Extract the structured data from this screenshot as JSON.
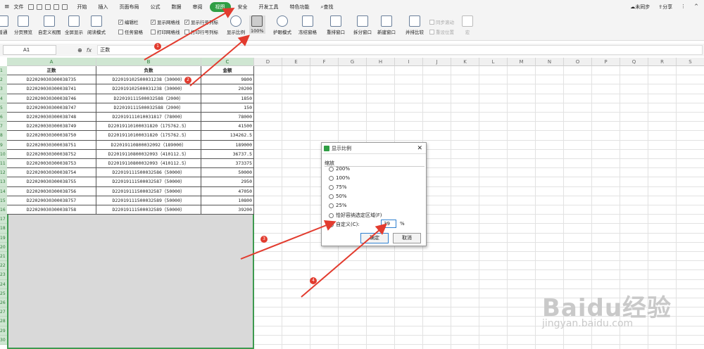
{
  "menubar": {
    "file_label": "文件",
    "tabs": [
      "开始",
      "插入",
      "页面布局",
      "公式",
      "数据",
      "审阅",
      "视图",
      "安全",
      "开发工具",
      "特色功能"
    ],
    "active_tab": "视图",
    "search_label": "查找",
    "sync_label": "未同步",
    "share_label": "分享"
  },
  "ribbon": {
    "buttons": [
      {
        "label": "普通"
      },
      {
        "label": "分页预览"
      },
      {
        "label": "自定义视图"
      },
      {
        "label": "全屏显示"
      },
      {
        "label": "阅读模式"
      },
      {
        "label": "显示比例"
      },
      {
        "label": "100%"
      },
      {
        "label": "护眼模式"
      },
      {
        "label": "冻结窗格"
      },
      {
        "label": "重排窗口"
      },
      {
        "label": "拆分窗口"
      },
      {
        "label": "新建窗口"
      },
      {
        "label": "并排比较"
      },
      {
        "label": "同步滚动"
      },
      {
        "label": "重设位置"
      },
      {
        "label": "宏"
      }
    ],
    "checks": [
      {
        "label": "编辑栏",
        "checked": true
      },
      {
        "label": "任务窗格",
        "checked": false
      },
      {
        "label": "显示网格线",
        "checked": true
      },
      {
        "label": "打印网格线",
        "checked": false
      },
      {
        "label": "显示行号列标",
        "checked": true
      },
      {
        "label": "打印行号列标",
        "checked": false
      }
    ]
  },
  "formula_bar": {
    "name_box": "A1",
    "fx": "fx",
    "value": "正数"
  },
  "columns": [
    "A",
    "B",
    "C",
    "D",
    "E",
    "F",
    "G",
    "H",
    "I",
    "J",
    "K",
    "L",
    "M",
    "N",
    "O",
    "P",
    "Q",
    "R",
    "S"
  ],
  "rows": [
    "1",
    "2",
    "3",
    "4",
    "5",
    "6",
    "7",
    "8",
    "9",
    "10",
    "11",
    "12",
    "13",
    "14",
    "15",
    "16",
    "17",
    "18",
    "19",
    "20",
    "21",
    "22",
    "23",
    "24",
    "25",
    "26",
    "27",
    "28",
    "29",
    "30"
  ],
  "sheet": {
    "headers": [
      "正数",
      "负数",
      "金额"
    ],
    "rows": [
      [
        "D22020030300038735",
        "D22019102500031238（30000）",
        "9800"
      ],
      [
        "D22020030300038741",
        "D22019102500031238（30000）",
        "20200"
      ],
      [
        "D22020030300038746",
        "D22019111500032588（2000）",
        "1850"
      ],
      [
        "D22020030300038747",
        "D22019111500032588（2000）",
        "150"
      ],
      [
        "D22020030300038748",
        "D22019111010031817（78000）",
        "78000"
      ],
      [
        "D22020030300038749",
        "D22019110100031820（175762.5）",
        "41500"
      ],
      [
        "D22020030300038750",
        "D22019110100031820（175762.5）",
        "134262.5"
      ],
      [
        "D22020030300038751",
        "D22019110800032092（189000）",
        "189000"
      ],
      [
        "D22020030300038752",
        "D22019110800032093（410112.5）",
        "36737.5"
      ],
      [
        "D22020030300038753",
        "D22019110800032093（410112.5）",
        "373375"
      ],
      [
        "D22020030300038754",
        "D22019111500032586（50000）",
        "50000"
      ],
      [
        "D22020030300038755",
        "D22019111500032587（50000）",
        "2950"
      ],
      [
        "D22020030300038756",
        "D22019111500032587（50000）",
        "47050"
      ],
      [
        "D22020030300038757",
        "D22019111500032589（50000）",
        "10800"
      ],
      [
        "D22020030300038758",
        "D22019111500032589（50000）",
        "39200"
      ]
    ]
  },
  "dialog": {
    "title": "显示比例",
    "group_label": "缩放",
    "options": [
      "200%",
      "100%",
      "75%",
      "50%",
      "25%",
      "恰好容纳选定区域(F)",
      "自定义(C):"
    ],
    "selected_option": "自定义(C):",
    "custom_value": "39",
    "percent_sign": "%",
    "ok_label": "确定",
    "cancel_label": "取消"
  },
  "annotations": {
    "markers": [
      "1",
      "2",
      "3",
      "4"
    ],
    "arrow_color": "#e23b2e"
  },
  "watermark": {
    "text": "Baidu经验",
    "url_text": "jingyan.baidu.com"
  }
}
